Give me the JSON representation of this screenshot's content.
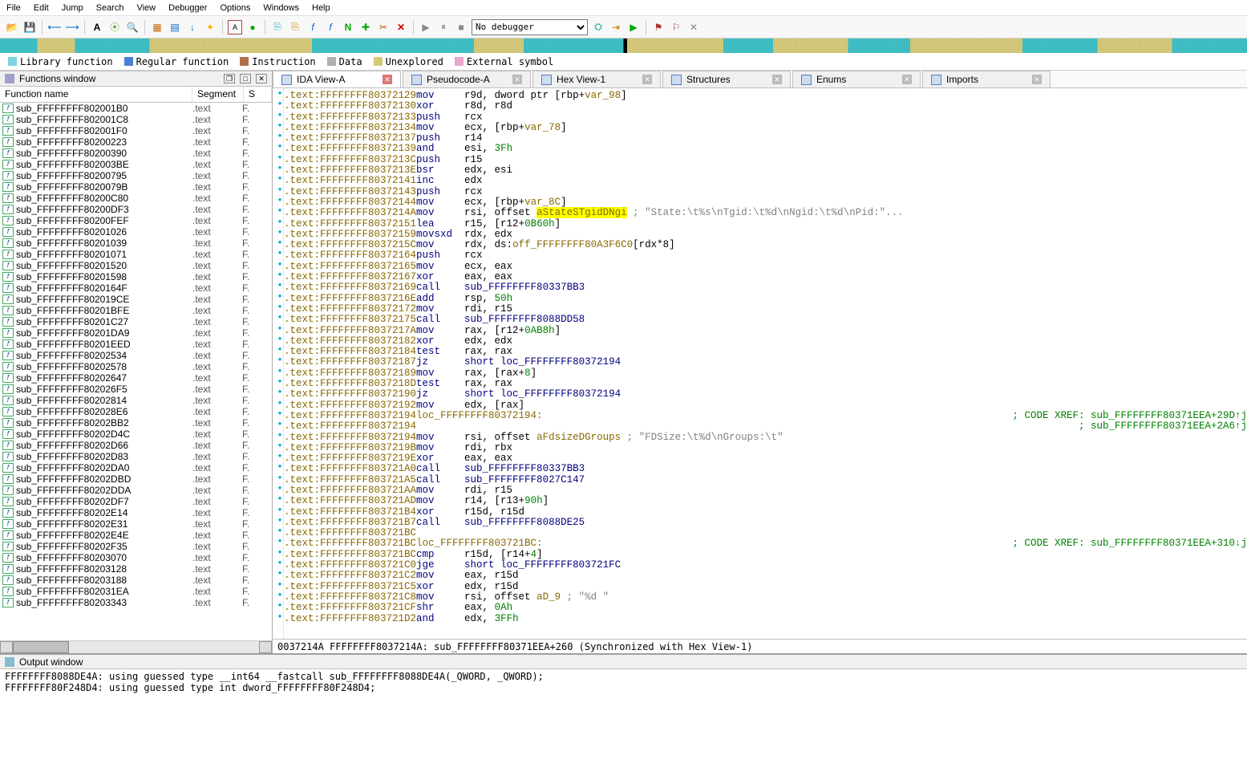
{
  "menu": [
    "File",
    "Edit",
    "Jump",
    "Search",
    "View",
    "Debugger",
    "Options",
    "Windows",
    "Help"
  ],
  "debugger_select": "No debugger",
  "legend": [
    {
      "color": "#7fd4e3",
      "label": "Library function"
    },
    {
      "color": "#4a7dd4",
      "label": "Regular function"
    },
    {
      "color": "#b0704a",
      "label": "Instruction"
    },
    {
      "color": "#b0b0b0",
      "label": "Data"
    },
    {
      "color": "#d4c97a",
      "label": "Unexplored"
    },
    {
      "color": "#e9a6cf",
      "label": "External symbol"
    }
  ],
  "functions_window": {
    "title": "Functions window",
    "headers": [
      "Function name",
      "Segment",
      "S"
    ],
    "rows": [
      {
        "name": "sub_FFFFFFFF802001B0",
        "seg": ".text",
        "s": "F."
      },
      {
        "name": "sub_FFFFFFFF802001C8",
        "seg": ".text",
        "s": "F."
      },
      {
        "name": "sub_FFFFFFFF802001F0",
        "seg": ".text",
        "s": "F."
      },
      {
        "name": "sub_FFFFFFFF80200223",
        "seg": ".text",
        "s": "F."
      },
      {
        "name": "sub_FFFFFFFF80200390",
        "seg": ".text",
        "s": "F."
      },
      {
        "name": "sub_FFFFFFFF802003BE",
        "seg": ".text",
        "s": "F."
      },
      {
        "name": "sub_FFFFFFFF80200795",
        "seg": ".text",
        "s": "F."
      },
      {
        "name": "sub_FFFFFFFF8020079B",
        "seg": ".text",
        "s": "F."
      },
      {
        "name": "sub_FFFFFFFF80200C80",
        "seg": ".text",
        "s": "F."
      },
      {
        "name": "sub_FFFFFFFF80200DF3",
        "seg": ".text",
        "s": "F."
      },
      {
        "name": "sub_FFFFFFFF80200FEF",
        "seg": ".text",
        "s": "F."
      },
      {
        "name": "sub_FFFFFFFF80201026",
        "seg": ".text",
        "s": "F."
      },
      {
        "name": "sub_FFFFFFFF80201039",
        "seg": ".text",
        "s": "F."
      },
      {
        "name": "sub_FFFFFFFF80201071",
        "seg": ".text",
        "s": "F."
      },
      {
        "name": "sub_FFFFFFFF80201520",
        "seg": ".text",
        "s": "F."
      },
      {
        "name": "sub_FFFFFFFF80201598",
        "seg": ".text",
        "s": "F."
      },
      {
        "name": "sub_FFFFFFFF8020164F",
        "seg": ".text",
        "s": "F."
      },
      {
        "name": "sub_FFFFFFFF802019CE",
        "seg": ".text",
        "s": "F."
      },
      {
        "name": "sub_FFFFFFFF80201BFE",
        "seg": ".text",
        "s": "F."
      },
      {
        "name": "sub_FFFFFFFF80201C27",
        "seg": ".text",
        "s": "F."
      },
      {
        "name": "sub_FFFFFFFF80201DA9",
        "seg": ".text",
        "s": "F."
      },
      {
        "name": "sub_FFFFFFFF80201EED",
        "seg": ".text",
        "s": "F."
      },
      {
        "name": "sub_FFFFFFFF80202534",
        "seg": ".text",
        "s": "F."
      },
      {
        "name": "sub_FFFFFFFF80202578",
        "seg": ".text",
        "s": "F."
      },
      {
        "name": "sub_FFFFFFFF80202647",
        "seg": ".text",
        "s": "F."
      },
      {
        "name": "sub_FFFFFFFF802026F5",
        "seg": ".text",
        "s": "F."
      },
      {
        "name": "sub_FFFFFFFF80202814",
        "seg": ".text",
        "s": "F."
      },
      {
        "name": "sub_FFFFFFFF802028E6",
        "seg": ".text",
        "s": "F."
      },
      {
        "name": "sub_FFFFFFFF80202BB2",
        "seg": ".text",
        "s": "F."
      },
      {
        "name": "sub_FFFFFFFF80202D4C",
        "seg": ".text",
        "s": "F."
      },
      {
        "name": "sub_FFFFFFFF80202D66",
        "seg": ".text",
        "s": "F."
      },
      {
        "name": "sub_FFFFFFFF80202D83",
        "seg": ".text",
        "s": "F."
      },
      {
        "name": "sub_FFFFFFFF80202DA0",
        "seg": ".text",
        "s": "F."
      },
      {
        "name": "sub_FFFFFFFF80202DBD",
        "seg": ".text",
        "s": "F."
      },
      {
        "name": "sub_FFFFFFFF80202DDA",
        "seg": ".text",
        "s": "F."
      },
      {
        "name": "sub_FFFFFFFF80202DF7",
        "seg": ".text",
        "s": "F."
      },
      {
        "name": "sub_FFFFFFFF80202E14",
        "seg": ".text",
        "s": "F."
      },
      {
        "name": "sub_FFFFFFFF80202E31",
        "seg": ".text",
        "s": "F."
      },
      {
        "name": "sub_FFFFFFFF80202E4E",
        "seg": ".text",
        "s": "F."
      },
      {
        "name": "sub_FFFFFFFF80202F35",
        "seg": ".text",
        "s": "F."
      },
      {
        "name": "sub_FFFFFFFF80203070",
        "seg": ".text",
        "s": "F."
      },
      {
        "name": "sub_FFFFFFFF80203128",
        "seg": ".text",
        "s": "F."
      },
      {
        "name": "sub_FFFFFFFF80203188",
        "seg": ".text",
        "s": "F."
      },
      {
        "name": "sub_FFFFFFFF802031EA",
        "seg": ".text",
        "s": "F."
      },
      {
        "name": "sub_FFFFFFFF80203343",
        "seg": ".text",
        "s": "F."
      }
    ]
  },
  "tabs": [
    {
      "label": "IDA View-A",
      "active": true,
      "close": "red"
    },
    {
      "label": "Pseudocode-A",
      "active": false,
      "close": "gray"
    },
    {
      "label": "Hex View-1",
      "active": false,
      "close": "gray"
    },
    {
      "label": "Structures",
      "active": false,
      "close": "gray"
    },
    {
      "label": "Enums",
      "active": false,
      "close": "gray"
    },
    {
      "label": "Imports",
      "active": false,
      "close": "gray"
    }
  ],
  "asm": [
    {
      "a": ".text:FFFFFFFF80372129",
      "m": "mov",
      "o": "r9d, dword ptr [rbp+",
      "v": "var_98",
      "o2": "]"
    },
    {
      "a": ".text:FFFFFFFF80372130",
      "m": "xor",
      "o": "r8d, r8d"
    },
    {
      "a": ".text:FFFFFFFF80372133",
      "m": "push",
      "o": "rcx"
    },
    {
      "a": ".text:FFFFFFFF80372134",
      "m": "mov",
      "o": "ecx, [rbp+",
      "v": "var_78",
      "o2": "]"
    },
    {
      "a": ".text:FFFFFFFF80372137",
      "m": "push",
      "o": "r14"
    },
    {
      "a": ".text:FFFFFFFF80372139",
      "m": "and",
      "o": "esi, ",
      "n": "3Fh"
    },
    {
      "a": ".text:FFFFFFFF8037213C",
      "m": "push",
      "o": "r15"
    },
    {
      "a": ".text:FFFFFFFF8037213E",
      "m": "bsr",
      "o": "edx, esi"
    },
    {
      "a": ".text:FFFFFFFF80372141",
      "m": "inc",
      "o": "edx"
    },
    {
      "a": ".text:FFFFFFFF80372143",
      "m": "push",
      "o": "rcx"
    },
    {
      "a": ".text:FFFFFFFF80372144",
      "m": "mov",
      "o": "ecx, [rbp+",
      "v": "var_8C",
      "o2": "]"
    },
    {
      "a": ".text:FFFFFFFF8037214A",
      "m": "mov",
      "o": "rsi, offset ",
      "hl": "aStateSTgidDNgi",
      "c": " ; \"State:\\t%s\\nTgid:\\t%d\\nNgid:\\t%d\\nPid:\"..."
    },
    {
      "a": ".text:FFFFFFFF80372151",
      "m": "lea",
      "o": "r15, [r12+",
      "n": "0B60h",
      "o2": "]"
    },
    {
      "a": ".text:FFFFFFFF80372159",
      "m": "movsxd",
      "o": "rdx, edx"
    },
    {
      "a": ".text:FFFFFFFF8037215C",
      "m": "mov",
      "o": "rdx, ds:",
      "off": "off_FFFFFFFF80A3F6C0",
      "o2": "[rdx*8]"
    },
    {
      "a": ".text:FFFFFFFF80372164",
      "m": "push",
      "o": "rcx"
    },
    {
      "a": ".text:FFFFFFFF80372165",
      "m": "mov",
      "o": "ecx, eax"
    },
    {
      "a": ".text:FFFFFFFF80372167",
      "m": "xor",
      "o": "eax, eax"
    },
    {
      "a": ".text:FFFFFFFF80372169",
      "m": "call",
      "l": "sub_FFFFFFFF80337BB3"
    },
    {
      "a": ".text:FFFFFFFF8037216E",
      "m": "add",
      "o": "rsp, ",
      "n": "50h"
    },
    {
      "a": ".text:FFFFFFFF80372172",
      "m": "mov",
      "o": "rdi, r15"
    },
    {
      "a": ".text:FFFFFFFF80372175",
      "m": "call",
      "l": "sub_FFFFFFFF8088DD58"
    },
    {
      "a": ".text:FFFFFFFF8037217A",
      "m": "mov",
      "o": "rax, [r12+",
      "n": "0AB8h",
      "o2": "]"
    },
    {
      "a": ".text:FFFFFFFF80372182",
      "m": "xor",
      "o": "edx, edx"
    },
    {
      "a": ".text:FFFFFFFF80372184",
      "m": "test",
      "o": "rax, rax"
    },
    {
      "a": ".text:FFFFFFFF80372187",
      "m": "jz",
      "l": "short loc_FFFFFFFF80372194"
    },
    {
      "a": ".text:FFFFFFFF80372189",
      "m": "mov",
      "o": "rax, [rax+",
      "n": "8",
      "o2": "]"
    },
    {
      "a": ".text:FFFFFFFF8037218D",
      "m": "test",
      "o": "rax, rax"
    },
    {
      "a": ".text:FFFFFFFF80372190",
      "m": "jz",
      "l": "short loc_FFFFFFFF80372194"
    },
    {
      "a": ".text:FFFFFFFF80372192",
      "m": "mov",
      "o": "edx, [rax]"
    },
    {
      "a": ".text:FFFFFFFF80372194",
      "label": "loc_FFFFFFFF80372194:",
      "xref": "; CODE XREF: sub_FFFFFFFF80371EEA+29D↑j"
    },
    {
      "a": ".text:FFFFFFFF80372194",
      "xref": "; sub_FFFFFFFF80371EEA+2A6↑j"
    },
    {
      "a": ".text:FFFFFFFF80372194",
      "m": "mov",
      "o": "rsi, offset ",
      "off": "aFdsizeDGroups",
      "c": " ; \"FDSize:\\t%d\\nGroups:\\t\""
    },
    {
      "a": ".text:FFFFFFFF8037219B",
      "m": "mov",
      "o": "rdi, rbx"
    },
    {
      "a": ".text:FFFFFFFF8037219E",
      "m": "xor",
      "o": "eax, eax"
    },
    {
      "a": ".text:FFFFFFFF803721A0",
      "m": "call",
      "l": "sub_FFFFFFFF80337BB3"
    },
    {
      "a": ".text:FFFFFFFF803721A5",
      "m": "call",
      "l": "sub_FFFFFFFF8027C147"
    },
    {
      "a": ".text:FFFFFFFF803721AA",
      "m": "mov",
      "o": "rdi, r15"
    },
    {
      "a": ".text:FFFFFFFF803721AD",
      "m": "mov",
      "o": "r14, [r13+",
      "n": "90h",
      "o2": "]"
    },
    {
      "a": ".text:FFFFFFFF803721B4",
      "m": "xor",
      "o": "r15d, r15d"
    },
    {
      "a": ".text:FFFFFFFF803721B7",
      "m": "call",
      "l": "sub_FFFFFFFF8088DE25"
    },
    {
      "a": ".text:FFFFFFFF803721BC"
    },
    {
      "a": ".text:FFFFFFFF803721BC",
      "label": "loc_FFFFFFFF803721BC:",
      "xref": "; CODE XREF: sub_FFFFFFFF80371EEA+310↓j"
    },
    {
      "a": ".text:FFFFFFFF803721BC",
      "m": "cmp",
      "o": "r15d, [r14+",
      "n": "4",
      "o2": "]"
    },
    {
      "a": ".text:FFFFFFFF803721C0",
      "m": "jge",
      "l": "short loc_FFFFFFFF803721FC"
    },
    {
      "a": ".text:FFFFFFFF803721C2",
      "m": "mov",
      "o": "eax, r15d"
    },
    {
      "a": ".text:FFFFFFFF803721C5",
      "m": "xor",
      "o": "edx, r15d"
    },
    {
      "a": ".text:FFFFFFFF803721C8",
      "m": "mov",
      "o": "rsi, offset ",
      "off": "aD_9",
      "c": " ; \"%d \""
    },
    {
      "a": ".text:FFFFFFFF803721CF",
      "m": "shr",
      "o": "eax, ",
      "n": "0Ah"
    },
    {
      "a": ".text:FFFFFFFF803721D2",
      "m": "and",
      "o": "edx, ",
      "n": "3FFh"
    }
  ],
  "status": "0037214A FFFFFFFF8037214A: sub_FFFFFFFF80371EEA+260 (Synchronized with Hex View-1)",
  "output": {
    "title": "Output window",
    "lines": [
      "FFFFFFFF8088DE4A: using guessed type __int64 __fastcall sub_FFFFFFFF8088DE4A(_QWORD, _QWORD);",
      "FFFFFFFF80F248D4: using guessed type int dword_FFFFFFFF80F248D4;"
    ]
  }
}
